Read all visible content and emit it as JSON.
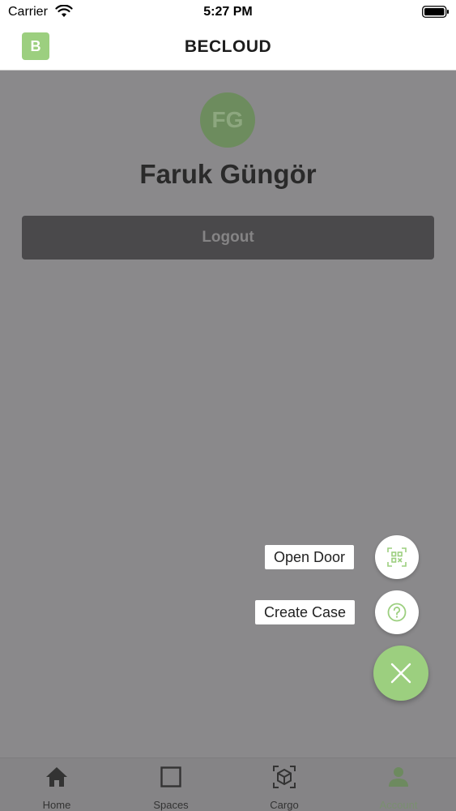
{
  "status_bar": {
    "carrier": "Carrier",
    "time": "5:27 PM"
  },
  "header": {
    "logo_letter": "B",
    "title": "BECLOUD"
  },
  "profile": {
    "initials": "FG",
    "name": "Faruk Güngör",
    "logout_label": "Logout"
  },
  "fab_menu": {
    "actions": [
      {
        "label": "Open Door",
        "icon": "qr-scan-icon"
      },
      {
        "label": "Create Case",
        "icon": "question-circle-icon"
      }
    ],
    "main_icon": "close-icon"
  },
  "tab_bar": {
    "items": [
      {
        "label": "Home",
        "icon": "home-icon"
      },
      {
        "label": "Spaces",
        "icon": "square-icon"
      },
      {
        "label": "Cargo",
        "icon": "package-icon"
      },
      {
        "label": "Account",
        "icon": "person-icon",
        "active": true
      }
    ]
  },
  "colors": {
    "accent": "#9ccf7f",
    "overlay": "#8a898b",
    "logout_bg": "#4a494b"
  }
}
